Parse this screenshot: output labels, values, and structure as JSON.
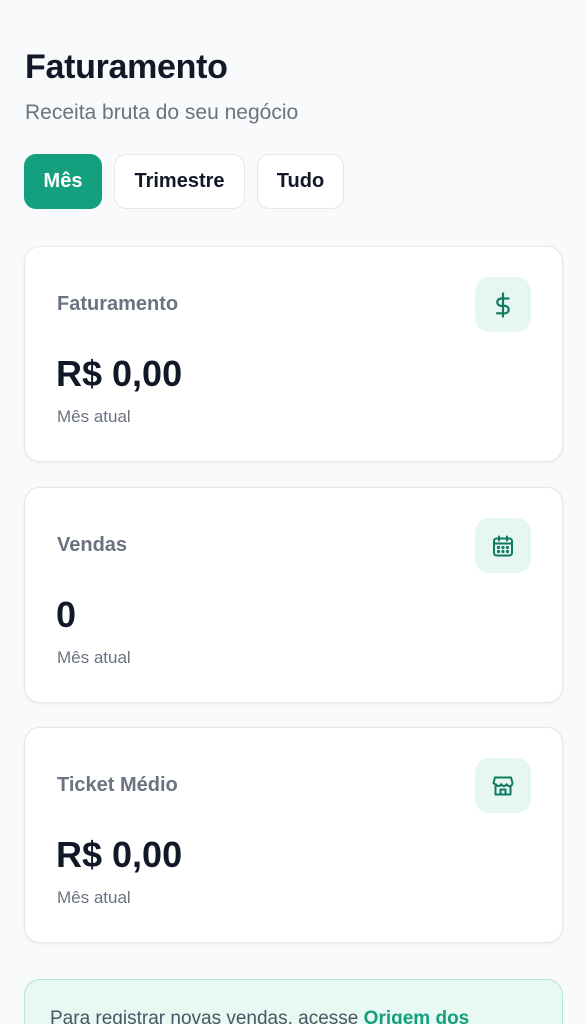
{
  "header": {
    "title": "Faturamento",
    "subtitle": "Receita bruta do seu negócio"
  },
  "filters": [
    {
      "label": "Mês",
      "active": true
    },
    {
      "label": "Trimestre",
      "active": false
    },
    {
      "label": "Tudo",
      "active": false
    }
  ],
  "cards": [
    {
      "label": "Faturamento",
      "value": "R$ 0,00",
      "caption": "Mês atual",
      "icon": "dollar-icon"
    },
    {
      "label": "Vendas",
      "value": "0",
      "caption": "Mês atual",
      "icon": "calendar-icon"
    },
    {
      "label": "Ticket Médio",
      "value": "R$ 0,00",
      "caption": "Mês atual",
      "icon": "store-icon"
    }
  ],
  "info": {
    "text": "Para registrar novas vendas, acesse ",
    "link": "Origem dos"
  },
  "colors": {
    "accent": "#14a07e",
    "icon_bg": "#e6f7f1",
    "icon_stroke": "#0f7a5f",
    "muted_text": "#6b7280"
  }
}
